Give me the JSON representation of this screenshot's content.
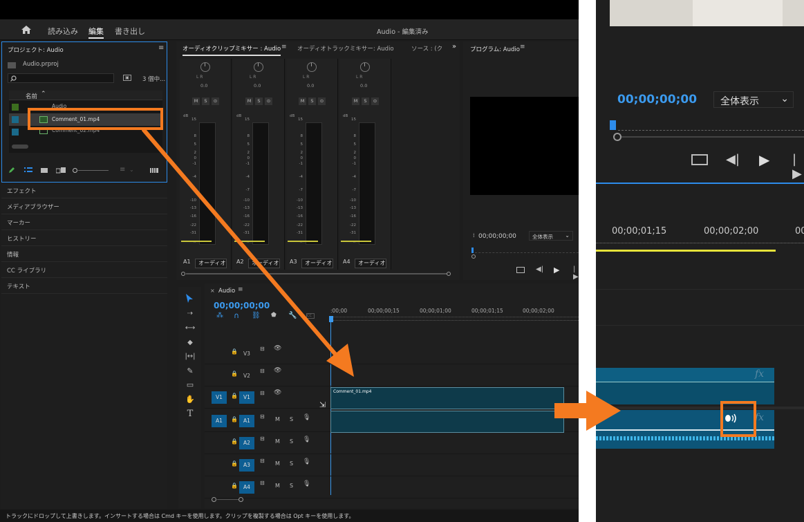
{
  "menubar": {
    "items": [
      "読み込み",
      "編集",
      "書き出し"
    ],
    "active": "編集",
    "title": "Audio - 編集済み"
  },
  "project": {
    "title": "プロジェクト: Audio",
    "file": "Audio.prproj",
    "count": "3 個中...",
    "column_name": "名前",
    "items": [
      {
        "name": "Audio",
        "color": "#3c6e1f"
      },
      {
        "name": "Comment_01.mp4",
        "color": "#1a6a8a"
      },
      {
        "name": "Comment_02.mp4",
        "color": "#1a6a8a"
      }
    ]
  },
  "left_panels": [
    "エフェクト",
    "メディアブラウザー",
    "マーカー",
    "ヒストリー",
    "情報",
    "CC ライブラリ",
    "テキスト"
  ],
  "mixer": {
    "tabs": [
      "オーディオクリップミキサー : Audio",
      "オーディオトラックミキサー: Audio",
      "ソース : (ク"
    ],
    "lr": "L  R",
    "pan_value": "0.0",
    "msb": [
      "M",
      "S",
      "⊙"
    ],
    "db": "dB",
    "scale": [
      "15",
      "8",
      "5",
      "2",
      "0",
      "-1",
      "-4",
      "-7",
      "-10",
      "-13",
      "-16",
      "-22",
      "-31",
      "-∞"
    ],
    "channels": [
      {
        "id": "A1",
        "name": "オーディオ"
      },
      {
        "id": "A2",
        "name": "オーディオ"
      },
      {
        "id": "A3",
        "name": "オーディオ"
      },
      {
        "id": "A4",
        "name": "オーディオ"
      }
    ]
  },
  "program": {
    "title": "プログラム: Audio",
    "timecode": "00;00;00;00",
    "zoom": "全体表示"
  },
  "timeline": {
    "tab": "Audio",
    "timecode": "00;00;00;00",
    "ruler": [
      ":00;00",
      "00;00;00;15",
      "00;00;01;00",
      "00;00;01;15",
      "00;00;02;00"
    ],
    "tracks": [
      {
        "id": "V3",
        "kind": "video"
      },
      {
        "id": "V2",
        "kind": "video"
      },
      {
        "id": "V1",
        "kind": "video",
        "source": "V1"
      },
      {
        "id": "A1",
        "kind": "audio",
        "source": "A1"
      },
      {
        "id": "A2",
        "kind": "audio"
      },
      {
        "id": "A3",
        "kind": "audio"
      },
      {
        "id": "A4",
        "kind": "audio"
      }
    ],
    "clip_name": "Comment_01.mp4",
    "m": "M",
    "s": "S"
  },
  "status": "トラックにドロップして上書きします。インサートする場合は Cmd キーを使用します。クリップを複製する場合は Opt キーを使用します。",
  "zoom": {
    "timecode": "00;00;00;00",
    "zoom_label": "全体表示",
    "ruler": [
      "00;00;01;15",
      "00;00;02;00",
      "00"
    ],
    "fx": "fx"
  },
  "colors": {
    "accent": "#2d8ceb",
    "highlight": "#f47a20",
    "track_blue": "#0d5e93"
  }
}
